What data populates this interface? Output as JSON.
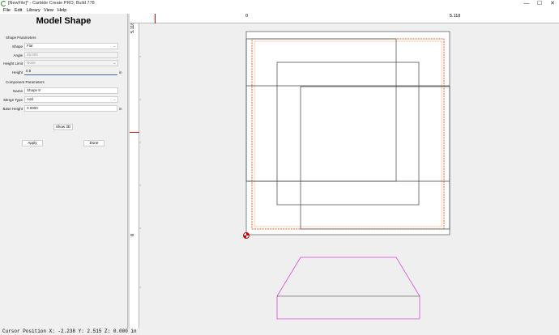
{
  "window": {
    "title": "[NewFile]* - Carbide Create PRO, Build 778",
    "minimize": "—",
    "maximize": "☐",
    "close": "✕"
  },
  "menu": [
    "File",
    "Edit",
    "Library",
    "View",
    "Help"
  ],
  "panel": {
    "title": "Model Shape",
    "shape_section": "Shape Parameters",
    "shape_label": "Shape",
    "shape_value": "Flat",
    "angle_label": "Angle",
    "angle_value": "45.000",
    "height_limit_label": "Height Limit",
    "height_limit_value": "None",
    "height_label": "Height",
    "height_value": "0.5",
    "height_unit": "in",
    "component_section": "Component Parameters",
    "name_label": "Name",
    "name_value": "Shape 9",
    "merge_label": "Merge Type",
    "merge_value": "Add",
    "base_label": "Base Height",
    "base_value": "0.0000",
    "base_unit": "in",
    "show3d": "Show 3D",
    "apply": "Apply",
    "done": "Done"
  },
  "rulers": {
    "top_zero": "0",
    "top_mark": "5.118",
    "left_mark": "5.118",
    "left_zero": "0"
  },
  "status": {
    "text": "Cursor Position X: -2.238 Y: 2.515 Z: 0.000 in"
  },
  "icons": {
    "app": "carbide-create-icon",
    "dropdown": "chevron-down-icon",
    "origin": "origin-marker-icon"
  },
  "colors": {
    "stock_outline": "#555555",
    "toolpath": "#e8601c",
    "profile": "#d84ad8",
    "ruler_marker": "#cc0000"
  }
}
